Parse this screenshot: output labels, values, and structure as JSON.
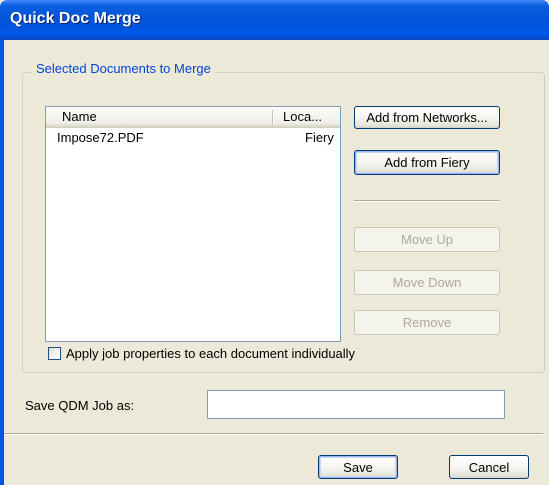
{
  "window": {
    "title": "Quick Doc Merge"
  },
  "group": {
    "legend": "Selected Documents to Merge"
  },
  "list": {
    "columns": [
      "Name",
      "Loca..."
    ],
    "rows": [
      {
        "name": "Impose72.PDF",
        "location": "Fiery"
      }
    ]
  },
  "buttons": {
    "add_networks": "Add from Networks...",
    "add_fiery": "Add from Fiery",
    "move_up": "Move Up",
    "move_down": "Move Down",
    "remove": "Remove",
    "save": "Save",
    "cancel": "Cancel"
  },
  "checkbox": {
    "label": "Apply job properties to each document individually",
    "checked": false
  },
  "save_job": {
    "label": "Save QDM Job as:",
    "value": ""
  },
  "colors": {
    "titlebar": "#0353d8",
    "legend_text": "#0046d5",
    "dialog_bg": "#ece9d8"
  }
}
